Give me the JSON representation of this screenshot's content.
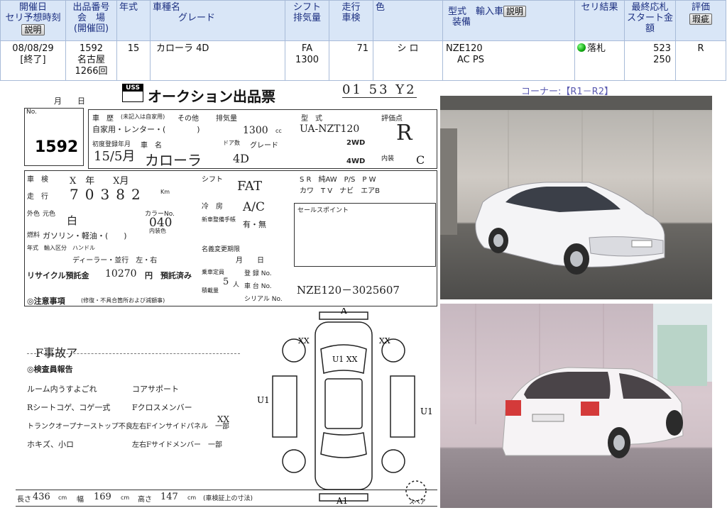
{
  "listing": {
    "headers": {
      "date": [
        "開催日",
        "セリ予想時刻"
      ],
      "date_button": "説明",
      "lot": [
        "出品番号",
        "会　場",
        "(開催回)"
      ],
      "year": "年式",
      "model": [
        "車種名",
        "グレード"
      ],
      "shift": [
        "シフト",
        "排気量"
      ],
      "mileage": [
        "走行",
        "車検"
      ],
      "color": "色",
      "type": [
        "型式　輸入車",
        "装備"
      ],
      "type_button": "説明",
      "result": "セリ結果",
      "bid": [
        "最終応札",
        "スタート金額"
      ],
      "grade": "評価",
      "grade_button": "瑕疵"
    },
    "row": {
      "date": "08/08/29",
      "status": "[終了]",
      "lot_no": "1592",
      "venue": "名古屋",
      "session": "1266回",
      "year": "15",
      "model": "カローラ 4D",
      "shift": "FA",
      "displacement": "1300",
      "mileage": "71",
      "color": "シ ロ",
      "type_code": "NZE120",
      "equipment": "AC PS",
      "result": "落札",
      "final_bid": "523",
      "start_price": "250",
      "grade": "R"
    }
  },
  "corner": "コーナー:【R1－R2】",
  "sheet": {
    "stamp": "01 53 Y2",
    "title": "オークション出品票",
    "logo": "USS",
    "month_day": "月　　日",
    "lot_label": "No.",
    "lot_no": "1592",
    "history_label": "車　歴",
    "history_sub": "(未記入は自家用)",
    "history_other": "その他",
    "history_value": "自家用・レンター・(　　　　)",
    "displacement_label": "排気量",
    "displacement_value": "1300",
    "displacement_unit": "cc",
    "model_code_label": "型　式",
    "model_code": "UA-NZT120",
    "grade_label": "評価点",
    "grade_value": "R",
    "first_reg_label": "初度登録年月",
    "first_reg_value": "15/5月",
    "car_name_label": "車　名",
    "car_name": "カローラ",
    "doors_label": "ドア数",
    "doors_value": "4D",
    "grade_name_label": "グレード",
    "drive_2wd": "2WD",
    "drive_4wd": "4WD",
    "interior_label": "内装",
    "interior_value": "C",
    "inspection_label": "車　検",
    "inspection_value": "X　年　　X月",
    "mileage_label": "走　行",
    "mileage_digits": [
      "7",
      "0",
      "3",
      "8",
      "2"
    ],
    "mileage_unit": "Km",
    "shift_label": "シフト",
    "shift_value": "FAT",
    "ac_label": "冷　房",
    "ac_value": "A/C",
    "exterior_label": "外色",
    "orig_color_label": "元色",
    "orig_color": "白",
    "color_no_label": "カラーNo.",
    "color_no": "040",
    "fuel_label": "燃料",
    "fuel_value": "ガソリン・軽油・(　　)",
    "interior_color_label": "内装色",
    "equipment_row": "S R　純AW　P/S　P W",
    "equipment_row2": "カワ　T V　ナビ　エアB",
    "sales_point": "セールスポイント",
    "warranty_label": "新車整備手帳",
    "warranty_value": "有・無",
    "import_label": "年式　輸入区分　ハンドル",
    "import_value": "ディーラー・並行　左・右",
    "name_change_label": "名義変更期限",
    "name_change_value": "月　　日",
    "recycle_label": "リサイクル預託金",
    "recycle_value": "10270",
    "recycle_unit": "円　預託済み",
    "capacity_label": "乗車定員",
    "capacity_value": "5",
    "capacity_unit": "人",
    "weight_label": "積載量",
    "reg_label": "登 録 No.",
    "chassis_label": "車 台 No.",
    "serial_label": "シリアル No.",
    "chassis_no": "NZE120－3025607",
    "notes_label": "◎注意事項",
    "notes_sub": "(修復・不具合箇所および減額事)",
    "accident_note": "F事故ア",
    "inspector_label": "◎検査員報告",
    "report_left": [
      "ルーム内うすよごれ",
      "Rシートコゲ、コゲ一式",
      "トランクオープナーストップ不良",
      "ホキズ、小ロ"
    ],
    "report_right": [
      "コアサポート",
      "Fクロスメンバー",
      "左右Fインサイドパネル　一部",
      "左右Fサイドメンバー　一部"
    ],
    "report_right_mark": "XX",
    "diagram_marks": {
      "top": "A",
      "bottom": "A1",
      "left": "U1",
      "right": "U1",
      "front_left": "XX",
      "front_right": "XX",
      "hood": "U1 XX"
    },
    "spare_label": "スペア",
    "length_label": "長さ",
    "length_value": "436",
    "width_label": "幅",
    "width_value": "169",
    "height_label": "高さ",
    "height_value": "147",
    "dim_unit": "cm",
    "dim_note": "(車検証上の寸法)"
  },
  "photos": {
    "photo1": "front-three-quarter view of white sedan in garage",
    "photo2": "rear-three-quarter view of white sedan in garage"
  }
}
